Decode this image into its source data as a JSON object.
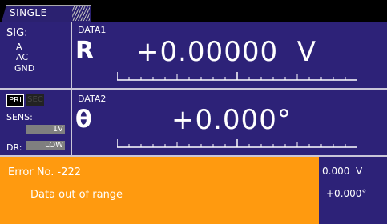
{
  "mode_tab": "SINGLE",
  "sig": {
    "label": "SIG:",
    "options": [
      "A",
      "AC",
      "GND"
    ]
  },
  "pri_label": "PRI",
  "sec_label": "SEC",
  "sens": {
    "label": "SENS:",
    "value": "1V"
  },
  "dr": {
    "label": "DR:",
    "value": "LOW"
  },
  "data1": {
    "label": "DATA1",
    "symbol": "R",
    "value": "+0.00000  V"
  },
  "data2": {
    "label": "DATA2",
    "symbol": "θ",
    "value": "+0.000°"
  },
  "error": {
    "title": "Error No. -222",
    "message": "Data out of range"
  },
  "mini": {
    "value1": "0.000  V",
    "value2": "+0.000°"
  },
  "colors": {
    "panel": "#2d2278",
    "error_bg": "#ff9a0f"
  }
}
